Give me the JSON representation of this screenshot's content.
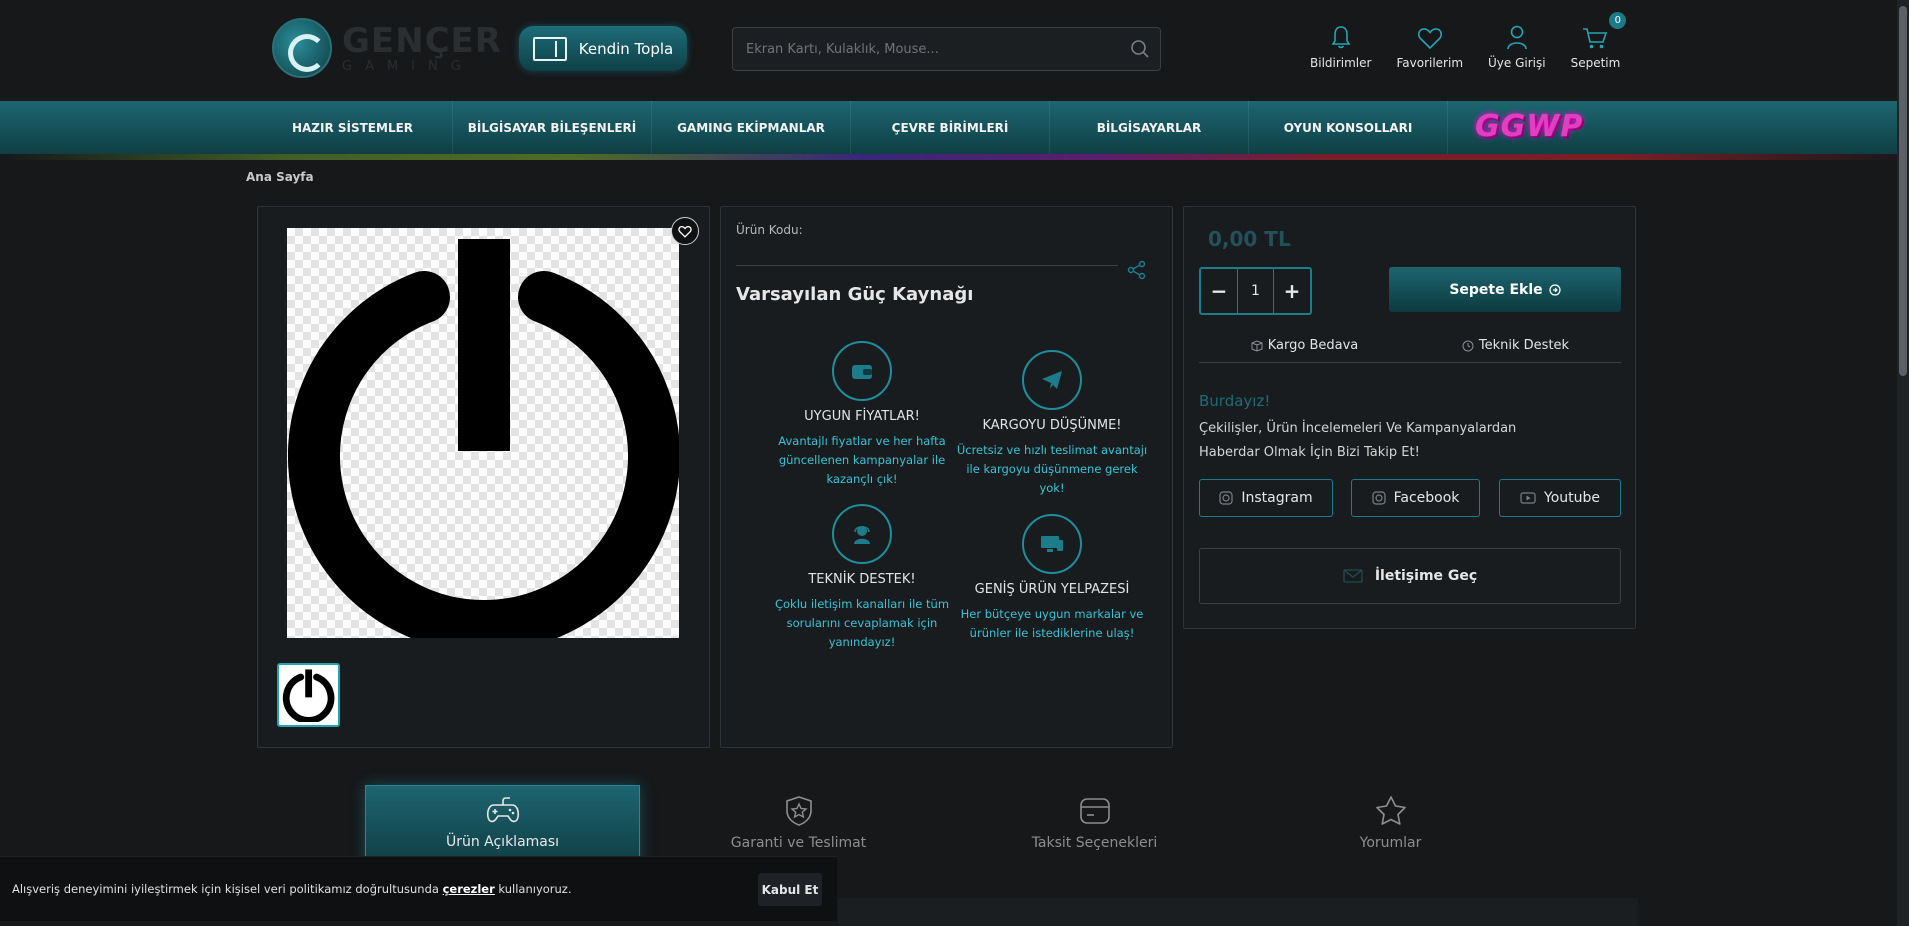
{
  "header": {
    "logo_name": "GENÇER",
    "logo_sub": "GAMING",
    "build_label": "Kendin Topla",
    "search_placeholder": "Ekran Kartı, Kulaklık, Mouse...",
    "actions": [
      {
        "label": "Bildirimler",
        "icon": "bell-icon"
      },
      {
        "label": "Favorilerim",
        "icon": "heart-icon"
      },
      {
        "label": "Üye Girişi",
        "icon": "user-icon"
      },
      {
        "label": "Sepetim",
        "icon": "cart-icon",
        "badge": "0"
      }
    ]
  },
  "nav": {
    "items": [
      "HAZIR SİSTEMLER",
      "BİLGİSAYAR BİLEŞENLERİ",
      "GAMING EKİPMANLAR",
      "ÇEVRE BİRİMLERİ",
      "BİLGİSAYARLAR",
      "OYUN KONSOLLARI"
    ],
    "promo": "GGWP"
  },
  "breadcrumb": "Ana Sayfa",
  "product": {
    "code_label": "Ürün Kodu:",
    "title": "Varsayılan Güç Kaynağı",
    "image_icon": "power-icon"
  },
  "features": [
    {
      "title": "UYGUN FİYATLAR!",
      "desc": "Avantajlı fiyatlar ve her hafta güncellenen kampanyalar ile kazançlı çık!",
      "icon": "wallet-icon"
    },
    {
      "title": "KARGOYU DÜŞÜNME!",
      "desc": "Ücretsiz ve hızlı teslimat avantajı ile kargoyu düşünmene gerek yok!",
      "icon": "send-icon"
    },
    {
      "title": "TEKNİK DESTEK!",
      "desc": "Çoklu iletişim kanalları ile tüm sorularını cevaplamak için yanındayız!",
      "icon": "support-icon"
    },
    {
      "title": "GENİŞ ÜRÜN YELPAZESİ",
      "desc": "Her bütçeye uygun markalar ve ürünler ile istediklerine ulaş!",
      "icon": "monitor-icon"
    }
  ],
  "buy": {
    "price": "0,00 TL",
    "qty_minus": "−",
    "qty_value": "1",
    "qty_plus": "+",
    "add_to_cart": "Sepete Ekle",
    "shipping": "Kargo Bedava",
    "support": "Teknik Destek",
    "follow_title": "Burdayız!",
    "follow_text": "Çekilişler, Ürün İncelemeleri Ve Kampanyalardan Haberdar Olmak İçin Bizi Takip Et!",
    "socials": [
      {
        "label": "Instagram",
        "icon": "instagram-icon"
      },
      {
        "label": "Facebook",
        "icon": "instagram-icon"
      },
      {
        "label": "Youtube",
        "icon": "youtube-icon"
      }
    ],
    "contact": "İletişime Geç"
  },
  "tabs": [
    {
      "label": "Ürün Açıklaması",
      "icon": "gamepad-icon",
      "active": true
    },
    {
      "label": "Garanti ve Teslimat",
      "icon": "shield-star-icon",
      "active": false
    },
    {
      "label": "Taksit Seçenekleri",
      "icon": "card-icon",
      "active": false
    },
    {
      "label": "Yorumlar",
      "icon": "star-icon",
      "active": false
    }
  ],
  "cookie": {
    "text_before": "Alışveriş deneyimini iyileştirmek için kişisel veri politikamız doğrultusunda ",
    "link": "çerezler",
    "text_after": " kullanıyoruz.",
    "accept": "Kabul Et"
  },
  "colors": {
    "accent": "#1d7c89",
    "accent_text": "#39c3d3",
    "background": "#16181a",
    "promo": "#e040c0"
  }
}
